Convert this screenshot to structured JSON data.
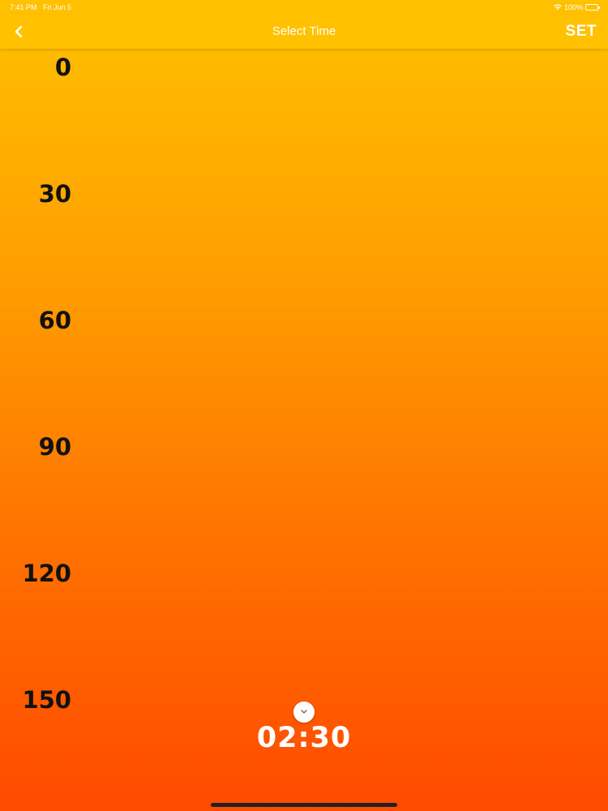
{
  "status_bar": {
    "time": "7:41 PM",
    "date": "Fri Jun 5",
    "battery": "100%",
    "wifi_icon": "wifi-icon",
    "battery_icon": "battery-icon"
  },
  "nav": {
    "back_icon": "chevron-left-icon",
    "title": "Select Time",
    "set_label": "SET"
  },
  "scale": {
    "labels": [
      "0",
      "30",
      "60",
      "90",
      "120",
      "150"
    ]
  },
  "timer": {
    "chevron_icon": "chevron-down-icon",
    "value": "02:30"
  },
  "colors": {
    "gradient_top": "#ffc100",
    "gradient_bottom": "#ff4a00",
    "nav_bg": "#ffc100",
    "label_color": "#111111"
  }
}
